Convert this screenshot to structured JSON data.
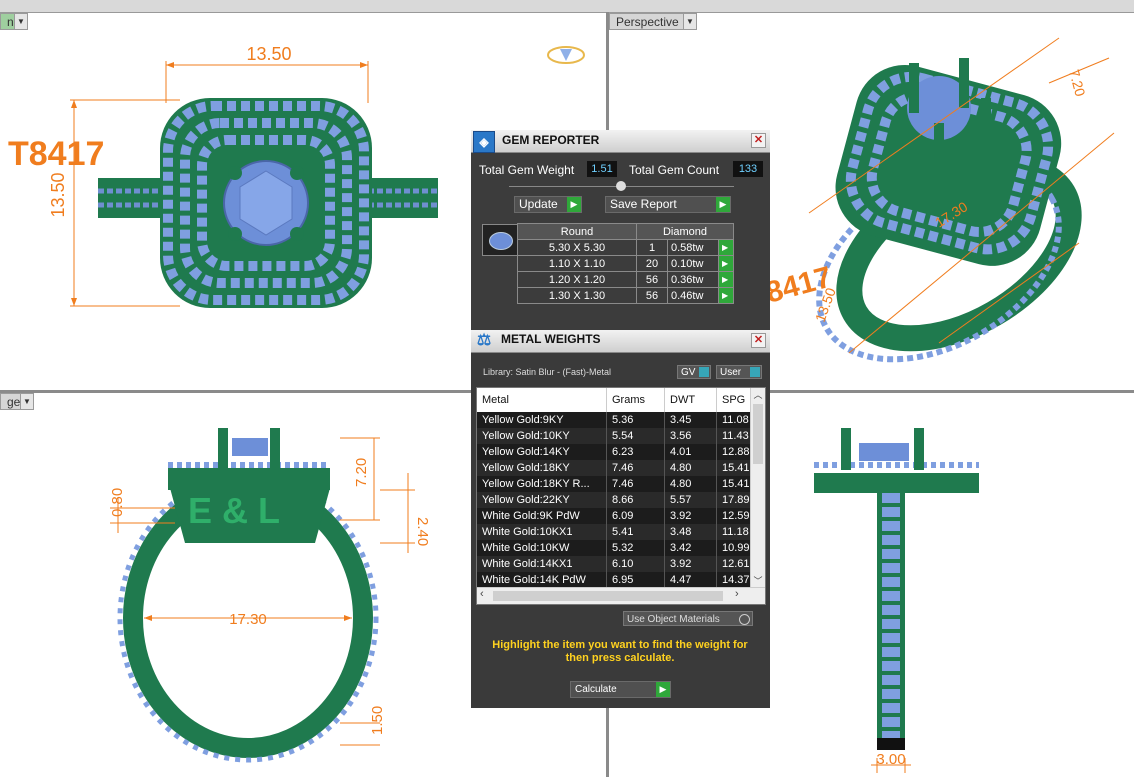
{
  "viewports": {
    "top_left": {
      "tab_label": "n",
      "dims": {
        "width": "13.50",
        "height": "13.50"
      },
      "engraving": "T8417"
    },
    "top_right": {
      "tab_label": "Perspective",
      "dims": {
        "d1": "7.20",
        "d2": "17.30",
        "d3": "13.50",
        "engraving_partial": "8417"
      }
    },
    "bottom_left": {
      "tab_label": "ger",
      "dims": {
        "top_height": "7.20",
        "setting": "2.40",
        "band": "0.80",
        "inner": "17.30",
        "shank": "1.50"
      },
      "engraving": "E & L"
    },
    "bottom_right": {
      "dims": {
        "width": "3.00"
      }
    }
  },
  "gem_reporter": {
    "title": "GEM REPORTER",
    "total_weight_label": "Total Gem Weight",
    "total_weight_value": "1.51",
    "total_count_label": "Total Gem Count",
    "total_count_value": "133",
    "update_label": "Update",
    "save_label": "Save Report",
    "shape_header": "Round",
    "material_header": "Diamond",
    "rows": [
      {
        "size": "5.30 X 5.30",
        "count": "1",
        "weight": "0.58tw"
      },
      {
        "size": "1.10 X 1.10",
        "count": "20",
        "weight": "0.10tw"
      },
      {
        "size": "1.20 X 1.20",
        "count": "56",
        "weight": "0.36tw"
      },
      {
        "size": "1.30 X 1.30",
        "count": "56",
        "weight": "0.46tw"
      }
    ]
  },
  "metal_weights": {
    "title": "METAL WEIGHTS",
    "library": "Library: Satin Blur - (Fast)-Metal",
    "gv_label": "GV",
    "user_label": "User",
    "columns": [
      "Metal",
      "Grams",
      "DWT",
      "SPG"
    ],
    "rows": [
      [
        "Yellow Gold:9KY",
        "5.36",
        "3.45",
        "11.08"
      ],
      [
        "Yellow Gold:10KY",
        "5.54",
        "3.56",
        "11.43"
      ],
      [
        "Yellow Gold:14KY",
        "6.23",
        "4.01",
        "12.88"
      ],
      [
        "Yellow Gold:18KY",
        "7.46",
        "4.80",
        "15.41"
      ],
      [
        "Yellow Gold:18KY R...",
        "7.46",
        "4.80",
        "15.41"
      ],
      [
        "Yellow Gold:22KY",
        "8.66",
        "5.57",
        "17.89"
      ],
      [
        "White Gold:9K PdW",
        "6.09",
        "3.92",
        "12.59"
      ],
      [
        "White Gold:10KX1",
        "5.41",
        "3.48",
        "11.18"
      ],
      [
        "White Gold:10KW",
        "5.32",
        "3.42",
        "10.99"
      ],
      [
        "White Gold:14KX1",
        "6.10",
        "3.92",
        "12.61"
      ],
      [
        "White Gold:14K PdW",
        "6.95",
        "4.47",
        "14.37"
      ]
    ],
    "use_object_materials": "Use Object Materials",
    "hint": "Highlight the item you want to find the weight for then press calculate.",
    "calculate_label": "Calculate"
  },
  "colors": {
    "metal": "#1f7a4e",
    "gem": "#7f9fe0",
    "dimension": "#f07d1e",
    "hint": "#ffd21f",
    "accent_green": "#2fa83a"
  }
}
